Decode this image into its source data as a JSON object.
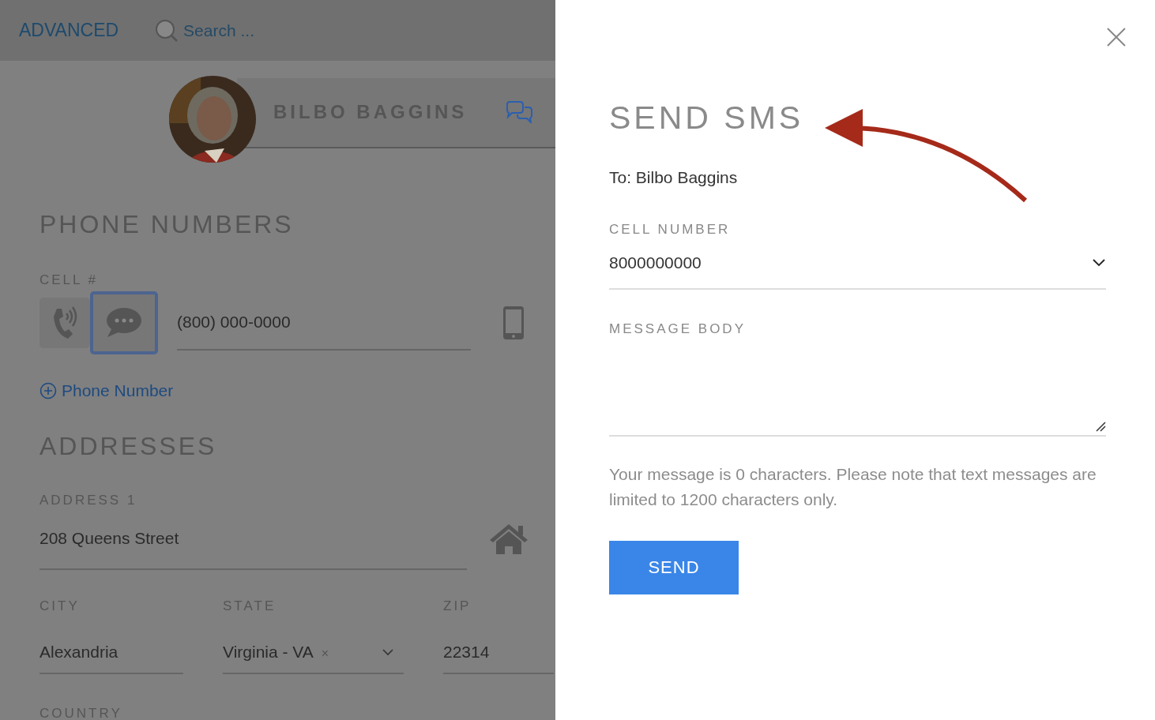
{
  "header": {
    "mode": "ADVANCED",
    "search": {
      "placeholder": "Search ..."
    }
  },
  "contact": {
    "name": "BILBO BAGGINS"
  },
  "phone_section": {
    "title": "PHONE NUMBERS",
    "label": "CELL #",
    "actions": [
      {
        "kind": "call",
        "selected": false
      },
      {
        "kind": "sms",
        "selected": true
      }
    ],
    "number": "(800) 000-0000",
    "add_link": "Phone Number"
  },
  "address_section": {
    "title": "ADDRESSES",
    "address_label": "ADDRESS 1",
    "address": "208 Queens Street",
    "city": {
      "label": "CITY",
      "value": "Alexandria"
    },
    "state": {
      "label": "STATE",
      "value": "Virginia - VA",
      "clear": "×"
    },
    "zip": {
      "label": "ZIP",
      "value": "22314"
    },
    "country_label": "COUNTRY"
  },
  "sms_panel": {
    "title": "SEND SMS",
    "to": "To: Bilbo Baggins",
    "cell_label": "CELL NUMBER",
    "cell_value": "8000000000",
    "body_label": "MESSAGE BODY",
    "note": "Your message is 0 characters. Please note that text messages are limited to 1200 characters only.",
    "send": "SEND"
  }
}
